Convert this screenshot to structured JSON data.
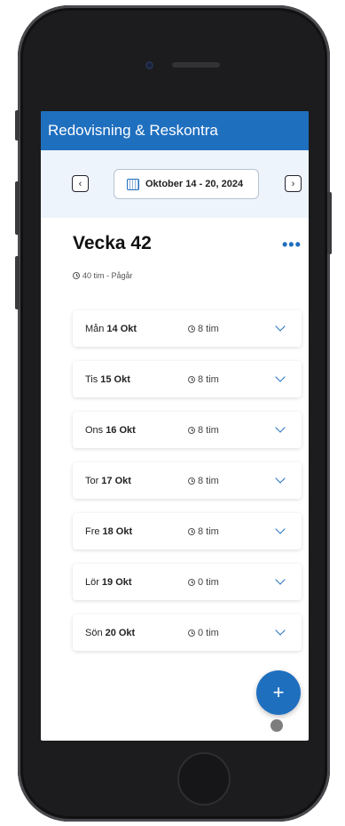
{
  "app": {
    "title": "Redovisning & Reskontra"
  },
  "datebar": {
    "prev_icon": "chevron-left-icon",
    "next_icon": "chevron-right-icon",
    "calendar_icon": "calendar-icon",
    "range_label": "Oktober 14 - 20, 2024"
  },
  "week": {
    "title": "Vecka 42",
    "summary": "40 tim - Pågår",
    "more_icon": "more-horizontal-icon"
  },
  "days": [
    {
      "weekday": "Mån",
      "date": "14 Okt",
      "hours": "8 tim"
    },
    {
      "weekday": "Tis",
      "date": "15 Okt",
      "hours": "8 tim"
    },
    {
      "weekday": "Ons",
      "date": "16 Okt",
      "hours": "8 tim"
    },
    {
      "weekday": "Tor",
      "date": "17 Okt",
      "hours": "8 tim"
    },
    {
      "weekday": "Fre",
      "date": "18 Okt",
      "hours": "8 tim"
    },
    {
      "weekday": "Lör",
      "date": "19 Okt",
      "hours": "0 tim"
    },
    {
      "weekday": "Sön",
      "date": "20 Okt",
      "hours": "0 tim"
    }
  ],
  "fab": {
    "label": "+",
    "icon": "plus-icon"
  },
  "colors": {
    "brand": "#1f6fbf",
    "background": "#eef4fb"
  }
}
